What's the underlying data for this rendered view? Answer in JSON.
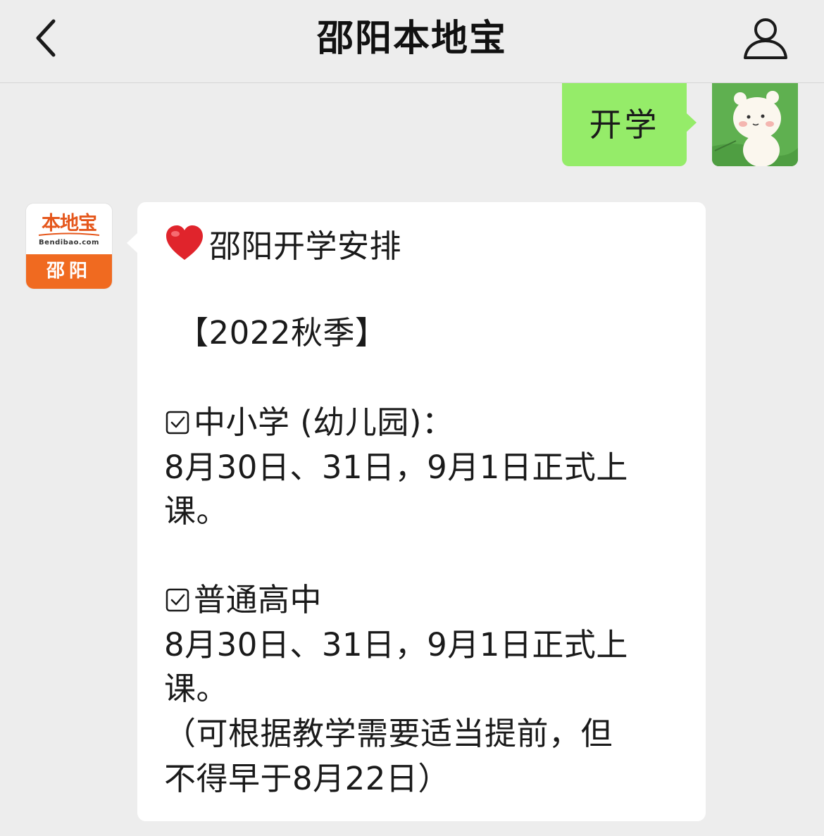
{
  "header": {
    "title": "邵阳本地宝",
    "back_icon": "chevron-left-icon",
    "profile_icon": "person-icon"
  },
  "messages": {
    "outgoing": {
      "text": "开学",
      "bubble_color": "#95ec69"
    },
    "incoming": {
      "avatar": {
        "logo_text": "本地宝",
        "domain_text": "Bendibao.com",
        "city_text": "邵阳",
        "brand_color": "#f06a20"
      },
      "heading": "邵阳开学安排",
      "season": "【2022秋季】",
      "section1_title": "中小学 (幼儿园)：",
      "section1_dates": "8月30日、31日，9月1日正式上",
      "section1_end": "课。",
      "section2_title": "普通高中",
      "section2_dates": "8月30日、31日，9月1日正式上",
      "section2_end": "课。",
      "note_line1": "（可根据教学需要适当提前，但",
      "note_line2": "不得早于8月22日）"
    }
  },
  "colors": {
    "background": "#ededed",
    "incoming_bubble": "#ffffff"
  }
}
